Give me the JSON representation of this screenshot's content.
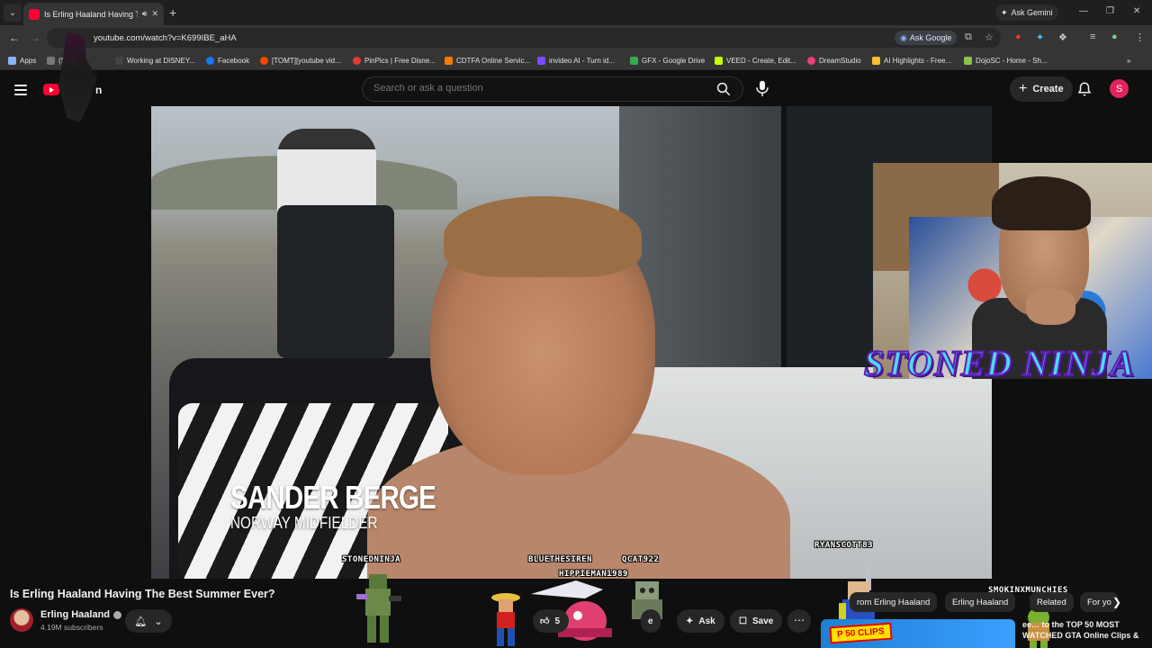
{
  "browser": {
    "tab_title": "Is Erling Haaland Having Th",
    "ask_gemini": "Ask Gemini",
    "url": "youtube.com/watch?v=K699IBE_aHA",
    "ask_google": "Ask Google",
    "bookmarks": [
      {
        "label": "Apps",
        "color": "#8ab4f8"
      },
      {
        "label": "(SLN)",
        "color": "#777777"
      },
      {
        "label": "Working at DISNEY...",
        "color": "#444444"
      },
      {
        "label": "Facebook",
        "color": "#1877f2"
      },
      {
        "label": "[TOMT][youtube vid...",
        "color": "#ff4500"
      },
      {
        "label": "PinPics | Free Disne...",
        "color": "#e53935"
      },
      {
        "label": "CDTFA Online Servic...",
        "color": "#f57c00"
      },
      {
        "label": "invideo AI - Turn id...",
        "color": "#7c4dff"
      },
      {
        "label": "GFX - Google Drive",
        "color": "#34a853"
      },
      {
        "label": "VEED - Create, Edit...",
        "color": "#c6ff00"
      },
      {
        "label": "DreamStudio",
        "color": "#ec407a"
      },
      {
        "label": "AI Highlights - Free...",
        "color": "#fbc02d"
      },
      {
        "label": "DojoSC - Home - Sh...",
        "color": "#8bc34a"
      }
    ]
  },
  "youtube": {
    "logo_text": "n",
    "search_placeholder": "Search or ask a question",
    "create_label": "Create",
    "avatar_letter": "S"
  },
  "video": {
    "lower_third_name": "SANDER BERGE",
    "lower_third_role": "NORWAY MIDFIELDER",
    "streamer_tag": "STONED NINJA",
    "viewers": [
      "STONEDNINJA",
      "BLUETHESIREN",
      "QCAT922",
      "HIPPIEMAN1989",
      "RYANSCOTT83",
      "SMOKINXMUNCHIES"
    ]
  },
  "watch": {
    "title": "Is Erling Haaland Having The Best Summer Ever?",
    "channel_name": "Erling Haaland",
    "subscribers": "4.19M subscribers",
    "like_count": "5",
    "share_fragment": "e",
    "ask_label": "Ask",
    "save_label": "Save"
  },
  "sidebar": {
    "chips": [
      "rom Erling Haaland",
      "Erling Haaland",
      "Related",
      "For yo"
    ],
    "rec_badge": "P 50 CLIPS",
    "rec_title": "ee… to the TOP 50 MOST WATCHED GTA Online Clips &"
  },
  "colors": {
    "youtube_red": "#ff0033",
    "streamer_tag_fill": "#4fd8f0",
    "streamer_tag_stroke": "#5b1fb0"
  }
}
